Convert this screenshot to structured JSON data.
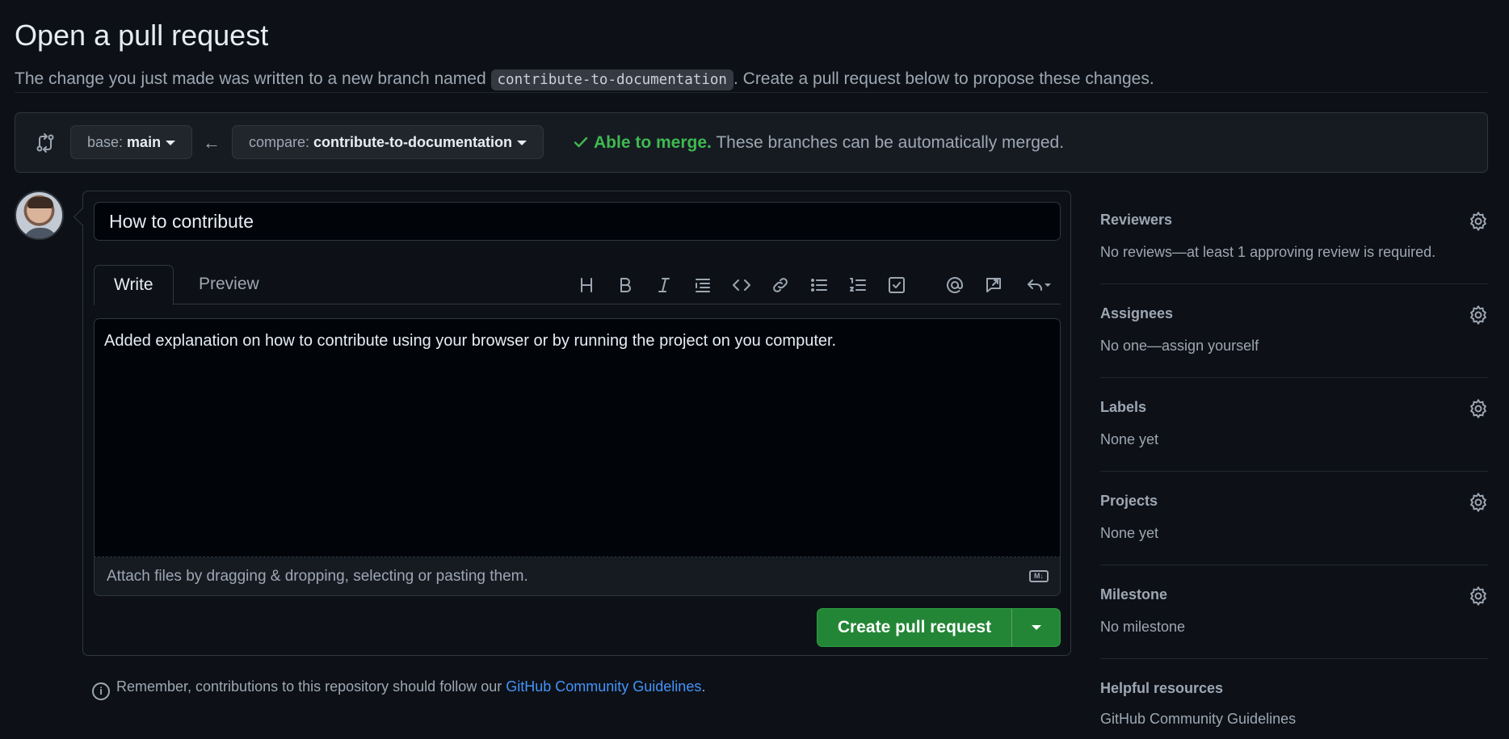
{
  "header": {
    "title": "Open a pull request",
    "subtitle_before": "The change you just made was written to a new branch named ",
    "branch_code": "contribute-to-documentation",
    "subtitle_after": ". Create a pull request below to propose these changes."
  },
  "range": {
    "base_prefix": "base: ",
    "base_branch": "main",
    "compare_prefix": "compare: ",
    "compare_branch": "contribute-to-documentation",
    "merge_ok": "Able to merge.",
    "merge_desc": " These branches can be automatically merged."
  },
  "form": {
    "title_value": "How to contribute",
    "tabs": [
      {
        "label": "Write",
        "active": true
      },
      {
        "label": "Preview",
        "active": false
      }
    ],
    "toolbar_icons": [
      "heading-icon",
      "bold-icon",
      "italic-icon",
      "quote-icon",
      "code-icon",
      "link-icon",
      "unordered-list-icon",
      "ordered-list-icon",
      "task-list-icon",
      "mention-icon",
      "reference-icon",
      "saved-replies-icon"
    ],
    "body_value": "Added explanation on how to contribute using your browser or by running the project on you computer.",
    "attach_text": "Attach files by dragging & dropping, selecting or pasting them.",
    "create_label": "Create pull request"
  },
  "footnote": {
    "text": "Remember, contributions to this repository should follow our ",
    "link": "GitHub Community Guidelines",
    "end": "."
  },
  "sidebar": {
    "sections": [
      {
        "heading": "Reviewers",
        "value": "No reviews—at least 1 approving review is required."
      },
      {
        "heading": "Assignees",
        "value": "No one—assign yourself"
      },
      {
        "heading": "Labels",
        "value": "None yet"
      },
      {
        "heading": "Projects",
        "value": "None yet"
      },
      {
        "heading": "Milestone",
        "value": "No milestone"
      }
    ],
    "helpful_heading": "Helpful resources",
    "helpful_link": "GitHub Community Guidelines"
  },
  "colors": {
    "background": "#0d1117",
    "accent_green": "#238636",
    "merge_green": "#3fb950",
    "link_blue": "#4493f8"
  }
}
